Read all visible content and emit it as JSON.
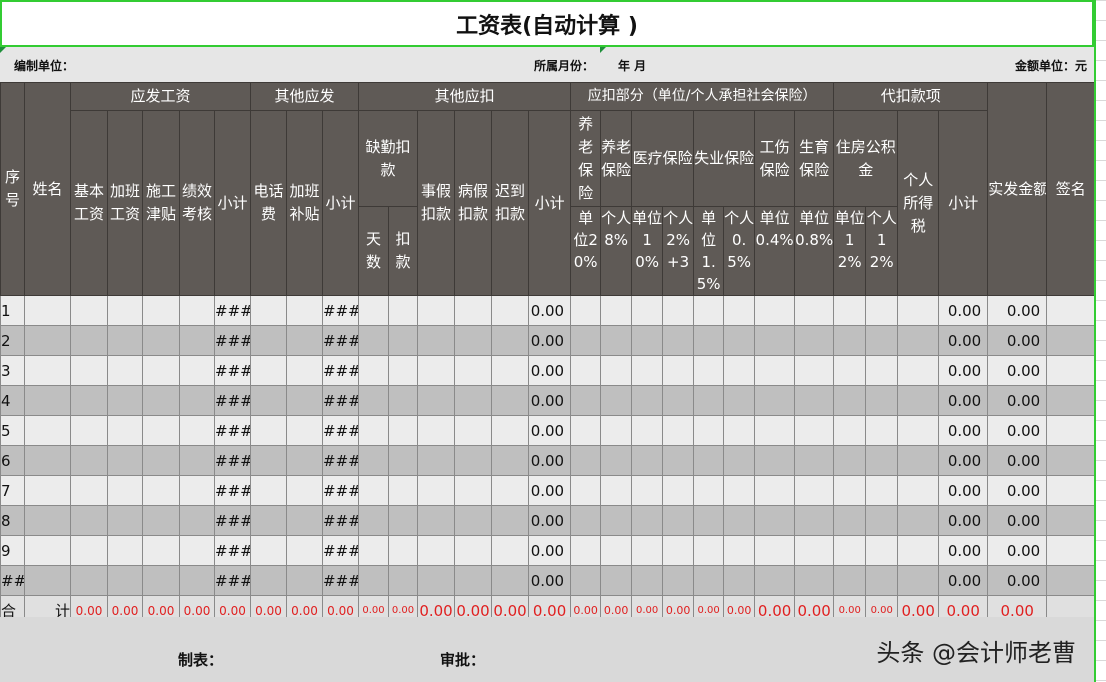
{
  "title": "工资表(自动计算 )",
  "meta": {
    "unit_label": "编制单位：",
    "month_label": "所属月份：",
    "year_month": "年  月",
    "amount_unit": "金额单位：元"
  },
  "headers": {
    "seq": "序号",
    "name": "姓名",
    "group_payable": "应发工资",
    "base": "基本工资",
    "overtime": "加班工资",
    "construction": "施工津贴",
    "performance": "绩效考核",
    "subtotal": "小计",
    "group_other_pay": "其他应发",
    "phone": "电话费",
    "overtime_subsidy": "加班补贴",
    "group_other_deduct": "其他应扣",
    "absence": "缺勤扣款",
    "days": "天数",
    "deduct": "扣款",
    "personal_leave": "事假扣款",
    "sick_leave": "病假扣款",
    "late": "迟到扣款",
    "group_insurance": "应扣部分（单位/个人承担社会保险）",
    "pension_unit": "养老保险",
    "pension_personal": "养老保险",
    "medical": "医疗保险",
    "unemployment": "失业保险",
    "injury": "工伤保险",
    "maternity": "生育保险",
    "rate_unit20": "单位20%",
    "rate_personal8": "个人8%",
    "rate_unit10": "单位10%",
    "rate_personal2": "个人2%+3",
    "rate_unit15": "单位1.5%",
    "rate_personal05": "个人0.5%",
    "rate_unit04": "单位0.4%",
    "rate_unit08": "单位0.8%",
    "group_withhold": "代扣款项",
    "housing": "住房公积金",
    "rate_unit12": "单位12%",
    "rate_personal12": "个人12%",
    "income_tax": "个人所得税",
    "net_pay": "实发金额",
    "signature": "签名"
  },
  "rows": [
    {
      "seq": "1",
      "sub1": "###",
      "sub2": "###",
      "sub3": "0.00",
      "sub4": "0.00",
      "net": "0.00"
    },
    {
      "seq": "2",
      "sub1": "###",
      "sub2": "###",
      "sub3": "0.00",
      "sub4": "0.00",
      "net": "0.00"
    },
    {
      "seq": "3",
      "sub1": "###",
      "sub2": "###",
      "sub3": "0.00",
      "sub4": "0.00",
      "net": "0.00"
    },
    {
      "seq": "4",
      "sub1": "###",
      "sub2": "###",
      "sub3": "0.00",
      "sub4": "0.00",
      "net": "0.00"
    },
    {
      "seq": "5",
      "sub1": "###",
      "sub2": "###",
      "sub3": "0.00",
      "sub4": "0.00",
      "net": "0.00"
    },
    {
      "seq": "6",
      "sub1": "###",
      "sub2": "###",
      "sub3": "0.00",
      "sub4": "0.00",
      "net": "0.00"
    },
    {
      "seq": "7",
      "sub1": "###",
      "sub2": "###",
      "sub3": "0.00",
      "sub4": "0.00",
      "net": "0.00"
    },
    {
      "seq": "8",
      "sub1": "###",
      "sub2": "###",
      "sub3": "0.00",
      "sub4": "0.00",
      "net": "0.00"
    },
    {
      "seq": "9",
      "sub1": "###",
      "sub2": "###",
      "sub3": "0.00",
      "sub4": "0.00",
      "net": "0.00"
    },
    {
      "seq": "##",
      "sub1": "###",
      "sub2": "###",
      "sub3": "0.00",
      "sub4": "0.00",
      "net": "0.00"
    }
  ],
  "total": {
    "label_a": "合",
    "label_b": "计",
    "values": [
      "0.00",
      "0.00",
      "0.00",
      "0.00",
      "0.00",
      "0.00",
      "0.00",
      "0.00",
      "0.00",
      "0.00",
      "0.00",
      "0.00",
      "0.00",
      "0.00",
      "0.00",
      "0.00",
      "0.00",
      "0.00",
      "0.00",
      "0.00",
      "0.00",
      "0.00",
      "0.00",
      "0.00",
      "0.00"
    ]
  },
  "footer": {
    "maker": "制表：",
    "approver": "审批：",
    "watermark": "头条 @会计师老曹"
  }
}
